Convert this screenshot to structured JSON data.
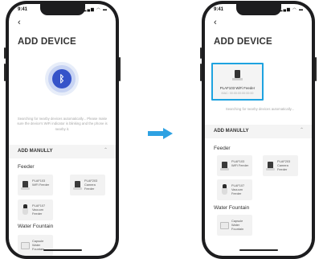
{
  "status_bar": {
    "time": "9:41",
    "icons": "▂▄▆ ◠ ▬"
  },
  "screen": {
    "back_glyph": "‹",
    "title": "ADD DEVICE"
  },
  "scan": {
    "bluetooth_glyph": "ᛒ",
    "hint": "Searching for nearby devices automatically... Please make sure the device's WiFi indicator is blinking and the phone is nearby it."
  },
  "manual": {
    "left_label": "ADD MANULLY",
    "right_label": "ADD MANULLY",
    "chevron": "⌃"
  },
  "sections": {
    "feeder": "Feeder",
    "fountain": "Water Fountain"
  },
  "devices": {
    "plaf103": "PLAF103 WiFi Feeder",
    "plaf203": "PLAF203 Camera Feeder",
    "plaf107": "PLAF107 Vacuum Feeder",
    "capsule": "Capsule Water Fountain"
  },
  "found_device": {
    "name": "PLAF103 WiFi Feeder",
    "mac": "MAC: 00:00:00:00:00:00"
  },
  "hint_right": "Searching for nearby devices automatically...",
  "colors": {
    "accent": "#2ea1e2",
    "bluetooth": "#3553c9",
    "highlight_border": "#1ea3e0"
  },
  "icons": [
    "back-icon",
    "bluetooth-icon",
    "chevron-up-icon",
    "arrow-right-icon"
  ]
}
